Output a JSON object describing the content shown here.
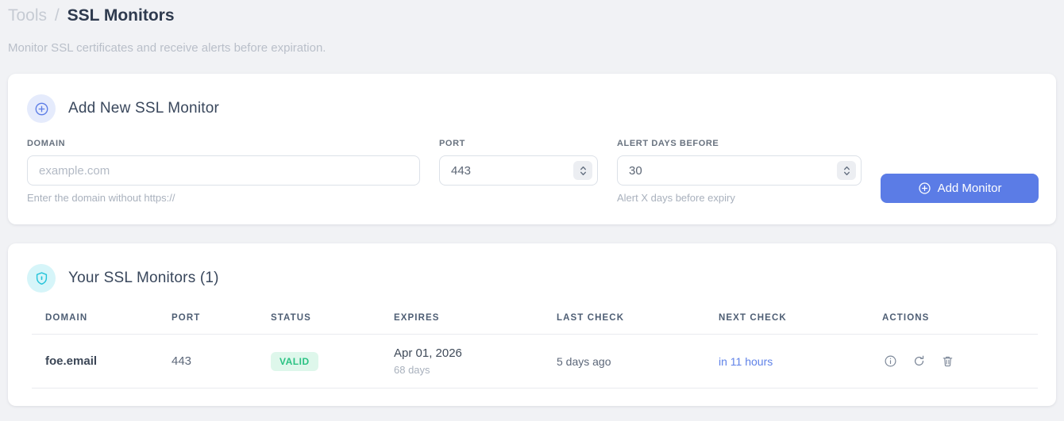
{
  "breadcrumb": {
    "parent": "Tools",
    "separator": "/",
    "current": "SSL Monitors"
  },
  "subtitle": "Monitor SSL certificates and receive alerts before expiration.",
  "add_form": {
    "title": "Add New SSL Monitor",
    "domain": {
      "label": "DOMAIN",
      "placeholder": "example.com",
      "help": "Enter the domain without https://"
    },
    "port": {
      "label": "PORT",
      "value": "443"
    },
    "alert_days": {
      "label": "ALERT DAYS BEFORE",
      "value": "30",
      "help": "Alert X days before expiry"
    },
    "submit_label": "Add Monitor"
  },
  "monitors": {
    "title": "Your SSL Monitors (1)",
    "count": 1,
    "columns": [
      "DOMAIN",
      "PORT",
      "STATUS",
      "EXPIRES",
      "LAST CHECK",
      "NEXT CHECK",
      "ACTIONS"
    ],
    "rows": [
      {
        "domain": "foe.email",
        "port": "443",
        "status": "VALID",
        "expires_date": "Apr 01, 2026",
        "expires_days": "68 days",
        "last_check": "5 days ago",
        "next_check": "in 11 hours"
      }
    ]
  },
  "colors": {
    "accent_blue": "#5b7ce6",
    "badge_blue_bg": "#e5ebfc",
    "cyan": "#25c4da",
    "badge_cyan_bg": "#d6f5f9",
    "valid_green": "#2ac283",
    "valid_bg": "#def7eb",
    "page_bg": "#f1f2f5"
  }
}
